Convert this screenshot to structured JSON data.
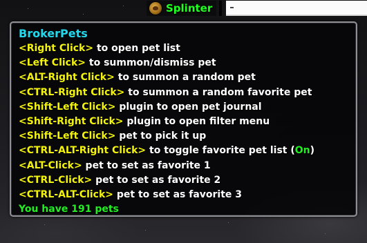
{
  "broker_bar": {
    "plugin_label": "Splinter",
    "plugin_icon": "pet-icon"
  },
  "tooltip": {
    "title": "BrokerPets",
    "lines": [
      {
        "key": "<Right Click>",
        "desc": " to open pet list"
      },
      {
        "key": "<Left Click>",
        "desc": " to summon/dismiss pet"
      },
      {
        "key": "<ALT-Right Click>",
        "desc": " to summon a random pet"
      },
      {
        "key": "<CTRL-Right Click>",
        "desc": " to summon a random favorite pet"
      },
      {
        "key": "<Shift-Left Click>",
        "desc": " plugin to open pet journal"
      },
      {
        "key": "<Shift-Right Click>",
        "desc": " plugin to open filter menu"
      },
      {
        "key": "<Shift-Left Click>",
        "desc": " pet to pick it up"
      },
      {
        "key": "<CTRL-ALT-Right Click>",
        "desc": " to toggle favorite pet list (",
        "status": "On",
        "desc_end": ")"
      },
      {
        "key": "<ALT-Click>",
        "desc": " pet to set as favorite 1"
      },
      {
        "key": "<CTRL-Click>",
        "desc": " pet to set as favorite 2"
      },
      {
        "key": "<CTRL-ALT-Click>",
        "desc": " pet to set as favorite 3"
      }
    ],
    "footer": "You have 191 pets"
  },
  "colors": {
    "title": "#22d8ec",
    "key": "#f3f30e",
    "desc": "#ffffff",
    "on": "#22ee22",
    "plugin_label": "#20ff20"
  }
}
